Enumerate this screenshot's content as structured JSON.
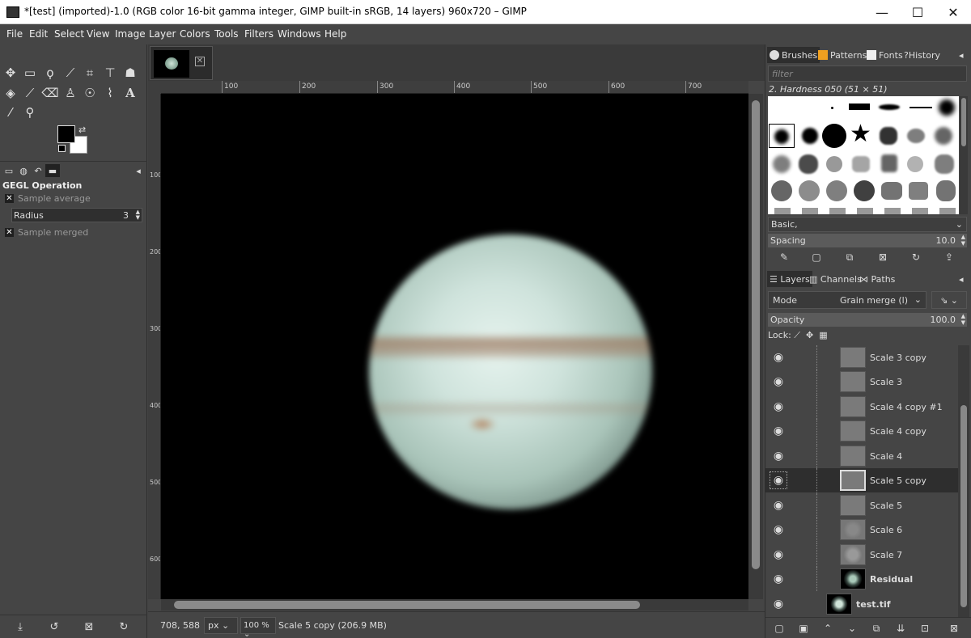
{
  "window": {
    "title": "*[test] (imported)-1.0 (RGB color 16-bit gamma integer, GIMP built-in sRGB, 14 layers) 960x720 – GIMP",
    "minimize": "—",
    "maximize": "☐",
    "close": "✕"
  },
  "menu": [
    "File",
    "Edit",
    "Select",
    "View",
    "Image",
    "Layer",
    "Colors",
    "Tools",
    "Filters",
    "Windows",
    "Help"
  ],
  "tool_options": {
    "header": "GEGL Operation",
    "sample_average": "Sample average",
    "radius_label": "Radius",
    "radius_value": "3",
    "sample_merged": "Sample merged"
  },
  "rulers": {
    "top": [
      "100",
      "200",
      "300",
      "400",
      "500",
      "600",
      "700"
    ],
    "left": [
      "100",
      "200",
      "300",
      "400",
      "500",
      "600"
    ]
  },
  "status": {
    "coords": "708, 588",
    "unit": "px",
    "zoom": "100 %",
    "info": "Scale 5 copy (206.9 MB)"
  },
  "brushes_dock": {
    "tabs": [
      "Brushes",
      "Patterns",
      "Fonts",
      "History"
    ],
    "filter_placeholder": "filter",
    "brush_name": "2. Hardness 050 (51 × 51)",
    "tag": "Basic,",
    "spacing_label": "Spacing",
    "spacing_value": "10.0"
  },
  "layers_dock": {
    "tabs": [
      "Layers",
      "Channels",
      "Paths"
    ],
    "mode_label": "Mode",
    "mode_value": "Grain merge (l)",
    "opacity_label": "Opacity",
    "opacity_value": "100.0",
    "lock_label": "Lock:",
    "layers": [
      {
        "name": "Scale 3 copy",
        "bold": false,
        "selected": false,
        "thumb": "gray"
      },
      {
        "name": "Scale 3",
        "bold": false,
        "selected": false,
        "thumb": "gray"
      },
      {
        "name": "Scale 4 copy #1",
        "bold": false,
        "selected": false,
        "thumb": "gray"
      },
      {
        "name": "Scale 4 copy",
        "bold": false,
        "selected": false,
        "thumb": "gray"
      },
      {
        "name": "Scale 4",
        "bold": false,
        "selected": false,
        "thumb": "gray"
      },
      {
        "name": "Scale 5 copy",
        "bold": false,
        "selected": true,
        "thumb": "gray"
      },
      {
        "name": "Scale 5",
        "bold": false,
        "selected": false,
        "thumb": "gray"
      },
      {
        "name": "Scale 6",
        "bold": false,
        "selected": false,
        "thumb": "gray-dot"
      },
      {
        "name": "Scale 7",
        "bold": false,
        "selected": false,
        "thumb": "gray-dot"
      },
      {
        "name": "Residual",
        "bold": true,
        "selected": false,
        "thumb": "planet"
      },
      {
        "name": "test.tif",
        "bold": true,
        "selected": false,
        "thumb": "planet"
      }
    ]
  }
}
